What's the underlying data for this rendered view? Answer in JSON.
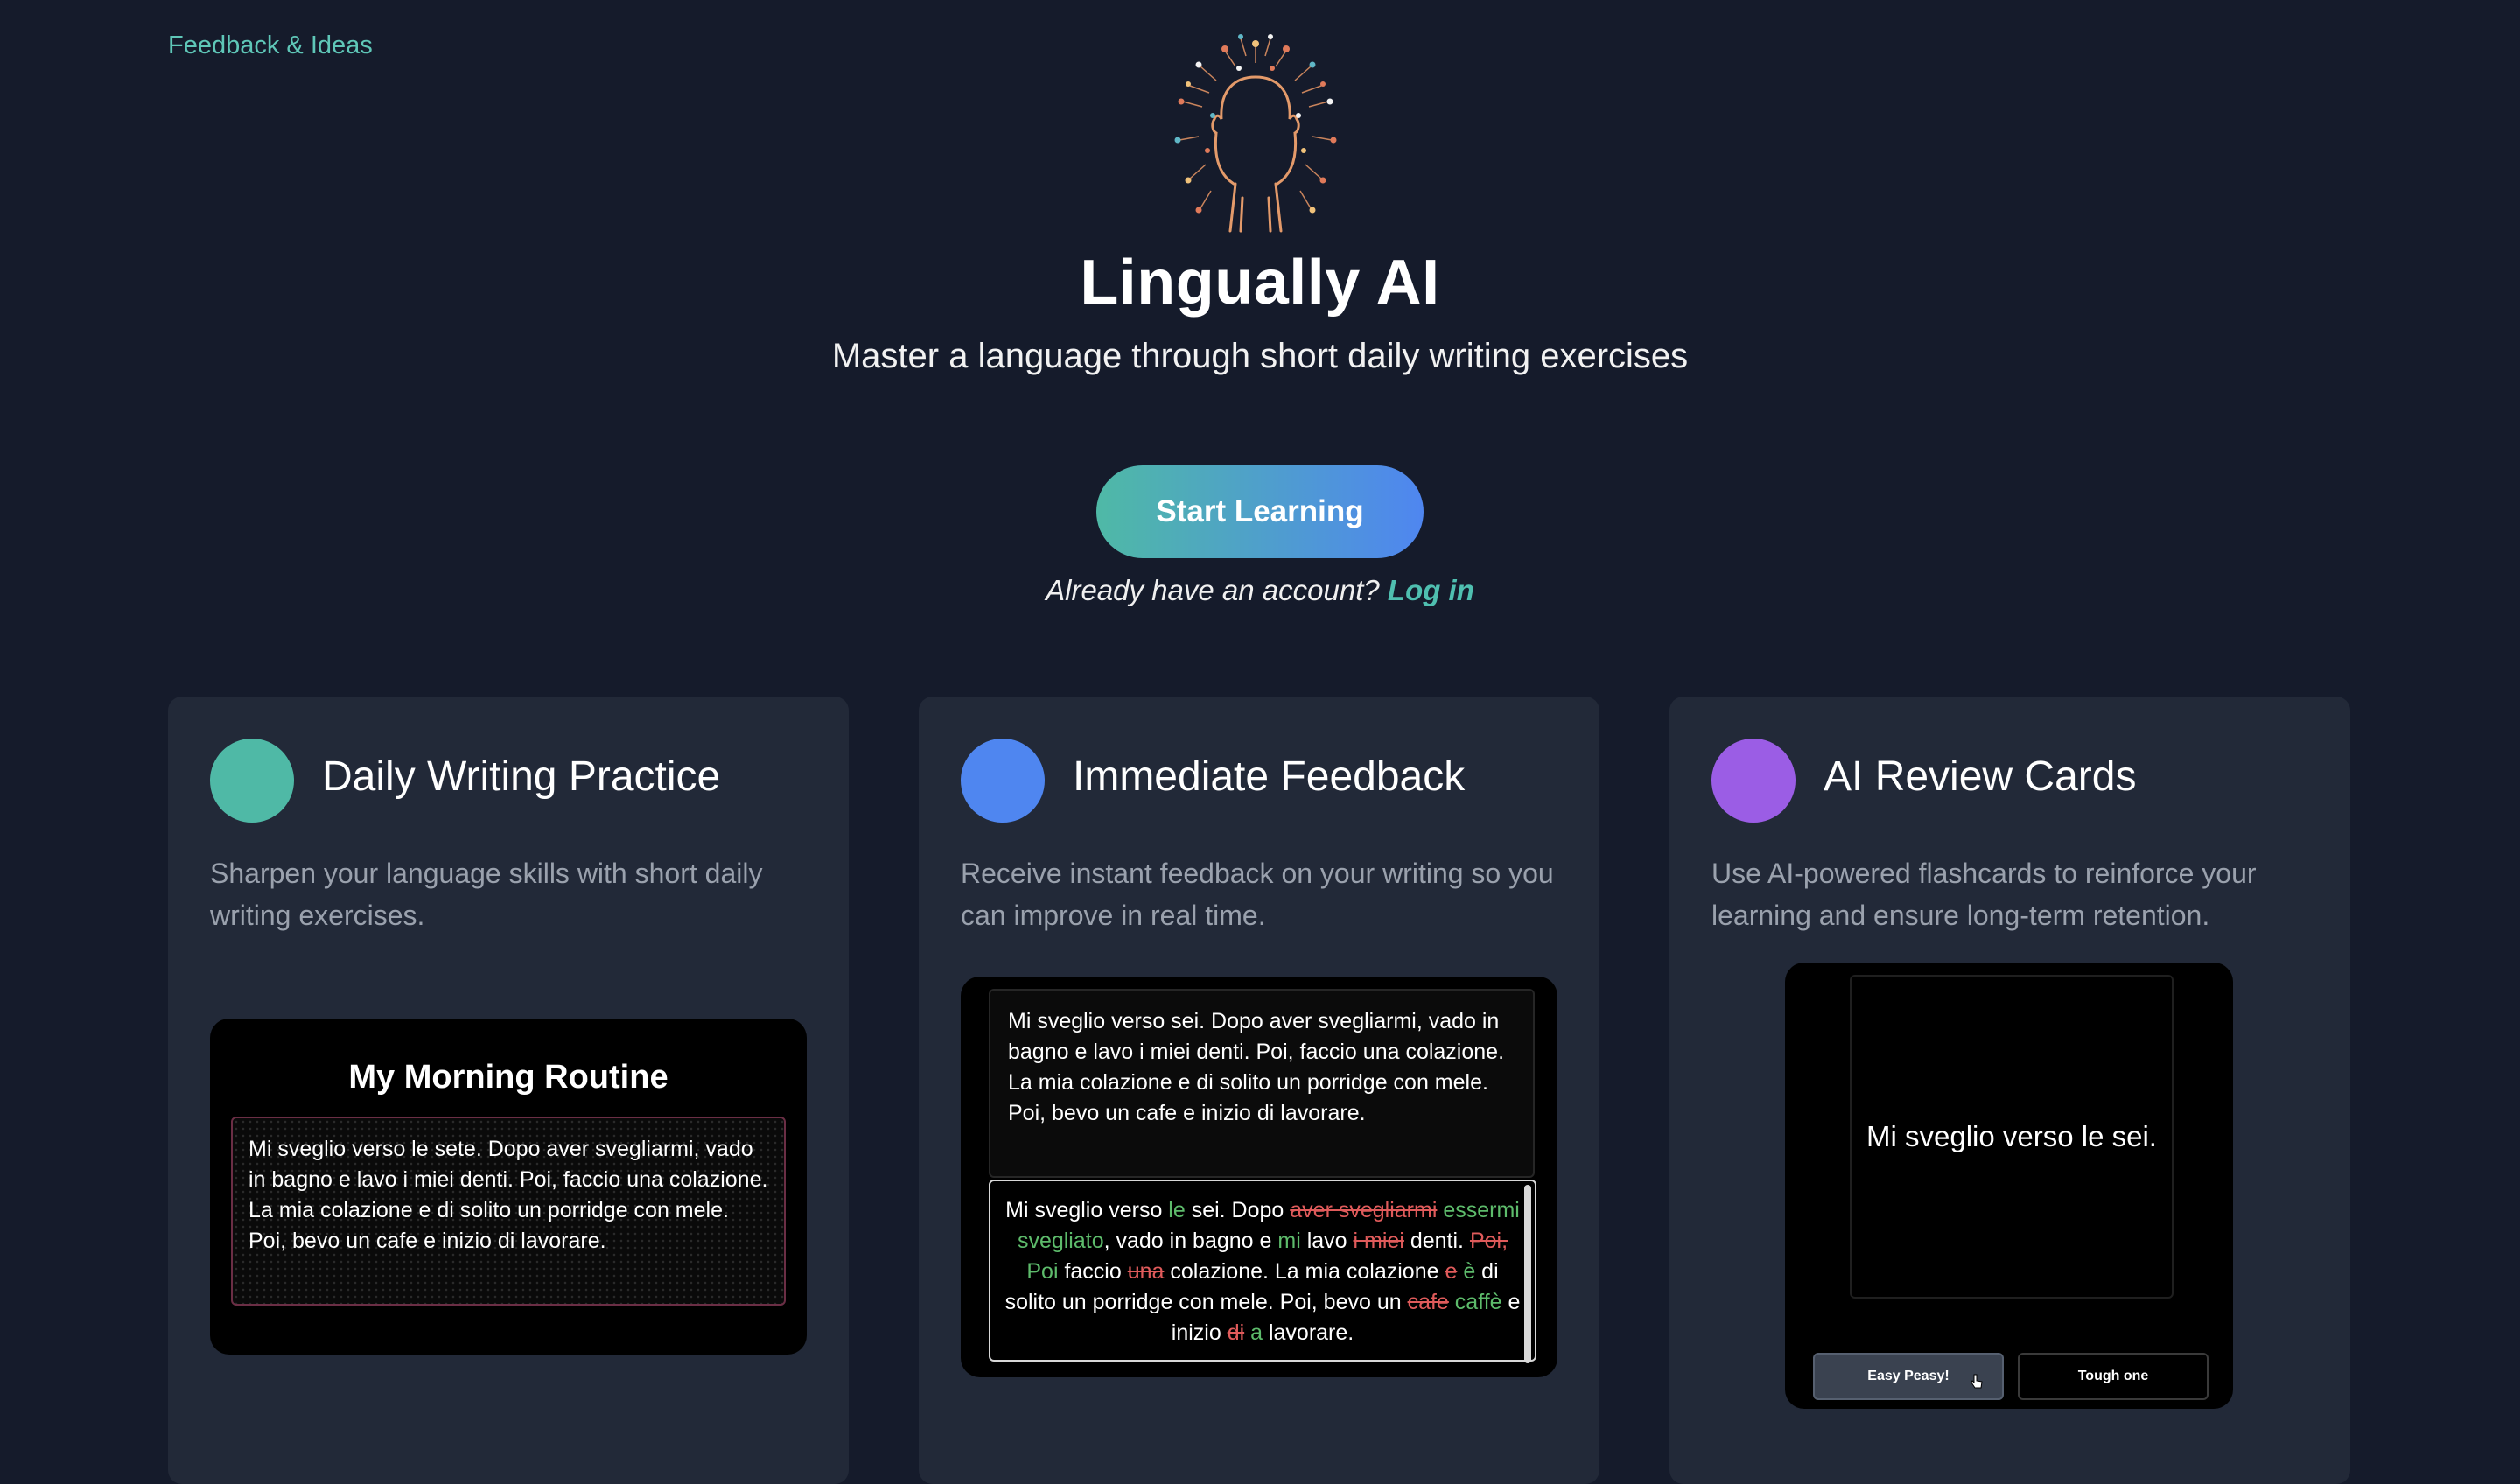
{
  "nav": {
    "feedback_link": "Feedback & Ideas"
  },
  "hero": {
    "logo_icon": "head-with-neural-network-icon",
    "title": "Lingually AI",
    "subtitle": "Master a language through short daily writing exercises",
    "cta_label": "Start Learning",
    "account_prompt": "Already have an account?",
    "login_label": "Log in"
  },
  "colors": {
    "background": "#151b2b",
    "card": "#222938",
    "accent_teal": "#4fb9a6",
    "accent_blue": "#4f86f0",
    "accent_purple": "#9b5de5",
    "insert_green": "#5dbb6b",
    "delete_red": "#e05b5b"
  },
  "features": [
    {
      "title": "Daily Writing Practice",
      "description": "Sharpen your language skills with short daily writing exercises.",
      "color": "#4fb9a6"
    },
    {
      "title": "Immediate Feedback",
      "description": "Receive instant feedback on your writing so you can improve in real time.",
      "color": "#4f86f0"
    },
    {
      "title": "AI Review Cards",
      "description": "Use AI-powered flashcards to reinforce your learning and ensure long-term retention.",
      "color": "#9b5de5"
    }
  ],
  "writing_demo": {
    "title": "My Morning Routine",
    "text": "Mi sveglio verso le sete. Dopo aver svegliarmi, vado in bagno e lavo i miei denti. Poi, faccio una colazione. La mia colazione e di solito un porridge con mele. Poi, bevo un cafe e inizio di lavorare."
  },
  "feedback_demo": {
    "original": "Mi sveglio verso sei. Dopo aver svegliarmi, vado in bagno e lavo i miei denti. Poi, faccio una colazione. La mia colazione e di solito un porridge con mele. Poi, bevo un cafe e inizio di lavorare.",
    "corrected": [
      {
        "t": "Mi sveglio verso ",
        "k": "same"
      },
      {
        "t": "le",
        "k": "ins"
      },
      {
        "t": " sei. Dopo ",
        "k": "same"
      },
      {
        "t": "aver svegliarmi",
        "k": "del"
      },
      {
        "t": " ",
        "k": "same"
      },
      {
        "t": "essermi svegliato",
        "k": "ins"
      },
      {
        "t": ", vado in bagno e ",
        "k": "same"
      },
      {
        "t": "mi",
        "k": "ins"
      },
      {
        "t": " lavo ",
        "k": "same"
      },
      {
        "t": "i miei",
        "k": "del"
      },
      {
        "t": " denti. ",
        "k": "same"
      },
      {
        "t": "Poi,",
        "k": "del"
      },
      {
        "t": " ",
        "k": "same"
      },
      {
        "t": "Poi",
        "k": "ins"
      },
      {
        "t": " faccio ",
        "k": "same"
      },
      {
        "t": "una",
        "k": "del"
      },
      {
        "t": " colazione. La mia colazione ",
        "k": "same"
      },
      {
        "t": "e",
        "k": "del"
      },
      {
        "t": " ",
        "k": "same"
      },
      {
        "t": "è",
        "k": "ins"
      },
      {
        "t": " di solito un porridge con mele. Poi, bevo un ",
        "k": "same"
      },
      {
        "t": "cafe",
        "k": "del"
      },
      {
        "t": " ",
        "k": "same"
      },
      {
        "t": "caffè",
        "k": "ins"
      },
      {
        "t": " e inizio ",
        "k": "same"
      },
      {
        "t": "di",
        "k": "del"
      },
      {
        "t": " ",
        "k": "same"
      },
      {
        "t": "a",
        "k": "ins"
      },
      {
        "t": " lavorare.",
        "k": "same"
      }
    ]
  },
  "review_demo": {
    "card_text": "Mi sveglio verso le sei.",
    "easy_label": "Easy Peasy!",
    "tough_label": "Tough one"
  }
}
